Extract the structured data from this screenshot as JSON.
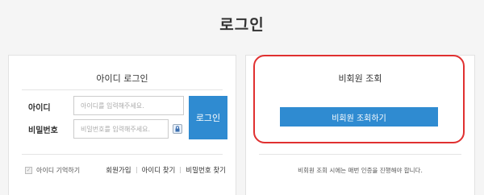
{
  "page": {
    "title": "로그인"
  },
  "member_login": {
    "heading": "아이디 로그인",
    "id_label": "아이디",
    "id_placeholder": "아이디를 입력해주세요.",
    "pw_label": "비밀번호",
    "pw_placeholder": "비밀번호를 입력해주세요.",
    "login_label": "로그인",
    "remember_label": "아이디 기억하기",
    "links": {
      "signup": "회원가입",
      "find_id": "아이디 찾기",
      "find_pw": "비밀번호 찾기"
    }
  },
  "guest_lookup": {
    "heading": "비회원 조회",
    "button_label": "비회원 조회하기",
    "note": "비회원 조회 시에는 매번 인증을 진행해야 합니다."
  },
  "colors": {
    "accent": "#2f8bd1",
    "highlight": "#e03030"
  },
  "icons": {
    "remember": "check-icon",
    "keyboard": "lock-icon"
  }
}
